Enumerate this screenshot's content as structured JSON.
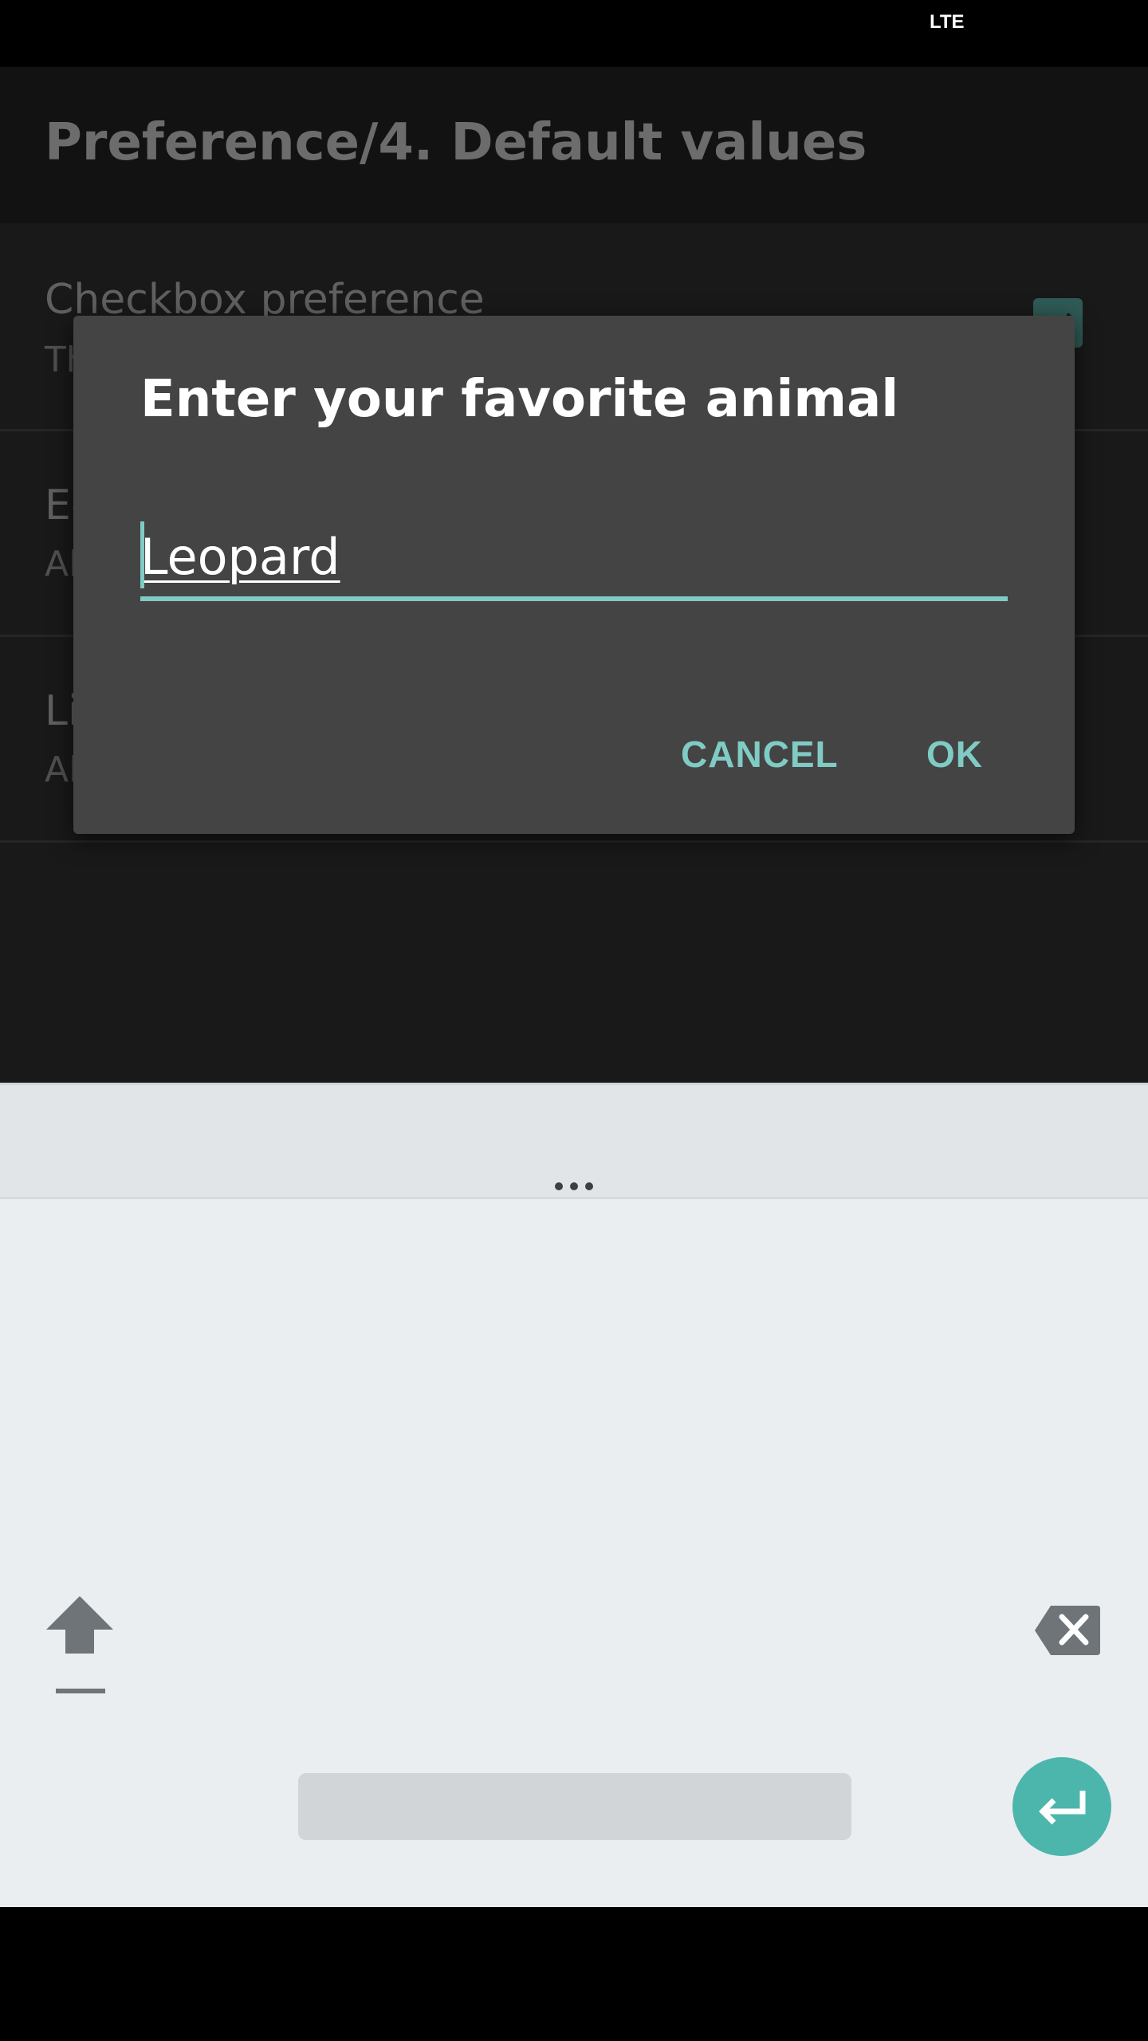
{
  "status_bar": {
    "network": "LTE"
  },
  "app_bar": {
    "title": "Preference/4. Default values"
  },
  "preferences": [
    {
      "title": "Checkbox preference",
      "summary": "Th"
    },
    {
      "title": "Ec",
      "summary": "Al"
    },
    {
      "title": "Li",
      "summary": "Al"
    }
  ],
  "dialog": {
    "title": "Enter your favorite animal",
    "input_value": "Leopard",
    "cancel_label": "CANCEL",
    "ok_label": "OK"
  },
  "keyboard": {
    "more_icon": "more-horizontal-icon",
    "shift_icon": "shift-arrow-icon",
    "backspace_icon": "backspace-icon",
    "enter_icon": "enter-return-icon"
  },
  "colors": {
    "accent": "#80cbc4",
    "enter_key": "#4db6ac",
    "dialog_bg": "#444444",
    "keyboard_bg": "#eaeef1"
  }
}
